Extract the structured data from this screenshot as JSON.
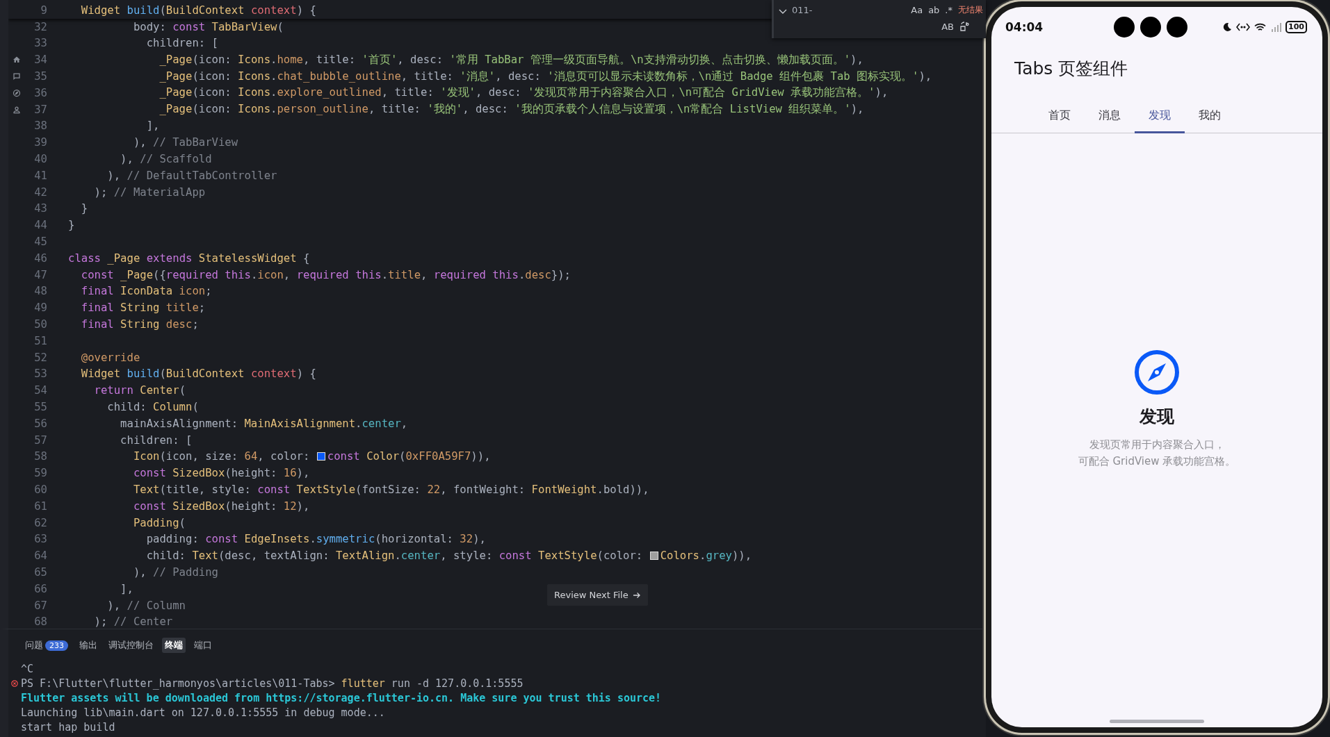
{
  "find_widget": {
    "value": "011-",
    "toggles": [
      "Aa",
      "ab",
      ".*"
    ],
    "result": "无结果",
    "replace_toggle": "AB"
  },
  "editor": {
    "sticky_line": {
      "num": "9",
      "tokens": [
        {
          "kind": "type",
          "text": "  Widget "
        },
        {
          "kind": "func",
          "text": "build"
        },
        {
          "kind": "plain",
          "text": "("
        },
        {
          "kind": "type",
          "text": "BuildContext "
        },
        {
          "kind": "var",
          "text": "context"
        },
        {
          "kind": "plain",
          "text": ") {"
        }
      ]
    },
    "lines": [
      {
        "num": "32",
        "tokens": [
          {
            "kind": "plain",
            "text": "          body: "
          },
          {
            "kind": "keyword",
            "text": "const "
          },
          {
            "kind": "type",
            "text": "TabBarView"
          },
          {
            "kind": "plain",
            "text": "("
          }
        ]
      },
      {
        "num": "33",
        "tokens": [
          {
            "kind": "plain",
            "text": "            children: ["
          }
        ]
      },
      {
        "num": "34",
        "kind": "home",
        "tokens": [
          {
            "kind": "type",
            "text": "              _Page"
          },
          {
            "kind": "plain",
            "text": "(icon: "
          },
          {
            "kind": "type",
            "text": "Icons"
          },
          {
            "kind": "plain",
            "text": "."
          },
          {
            "kind": "prop",
            "text": "home"
          },
          {
            "kind": "plain",
            "text": ", title: "
          },
          {
            "kind": "string",
            "text": "'首页'"
          },
          {
            "kind": "plain",
            "text": ", desc: "
          },
          {
            "kind": "string",
            "text": "'常用 TabBar 管理一级页面导航。\\n支持滑动切换、点击切换、懒加载页面。'"
          },
          {
            "kind": "plain",
            "text": "),"
          }
        ]
      },
      {
        "num": "35",
        "kind": "chat",
        "tokens": [
          {
            "kind": "type",
            "text": "              _Page"
          },
          {
            "kind": "plain",
            "text": "(icon: "
          },
          {
            "kind": "type",
            "text": "Icons"
          },
          {
            "kind": "plain",
            "text": "."
          },
          {
            "kind": "prop",
            "text": "chat_bubble_outline"
          },
          {
            "kind": "plain",
            "text": ", title: "
          },
          {
            "kind": "string",
            "text": "'消息'"
          },
          {
            "kind": "plain",
            "text": ", desc: "
          },
          {
            "kind": "string",
            "text": "'消息页可以显示未读数角标，\\n通过 Badge 组件包裹 Tab 图标实现。'"
          },
          {
            "kind": "plain",
            "text": "),"
          }
        ]
      },
      {
        "num": "36",
        "kind": "compass",
        "tokens": [
          {
            "kind": "type",
            "text": "              _Page"
          },
          {
            "kind": "plain",
            "text": "(icon: "
          },
          {
            "kind": "type",
            "text": "Icons"
          },
          {
            "kind": "plain",
            "text": "."
          },
          {
            "kind": "prop",
            "text": "explore_outlined"
          },
          {
            "kind": "plain",
            "text": ", title: "
          },
          {
            "kind": "string",
            "text": "'发现'"
          },
          {
            "kind": "plain",
            "text": ", desc: "
          },
          {
            "kind": "string",
            "text": "'发现页常用于内容聚合入口，\\n可配合 GridView 承载功能宫格。'"
          },
          {
            "kind": "plain",
            "text": "),"
          }
        ]
      },
      {
        "num": "37",
        "kind": "person",
        "tokens": [
          {
            "kind": "type",
            "text": "              _Page"
          },
          {
            "kind": "plain",
            "text": "(icon: "
          },
          {
            "kind": "type",
            "text": "Icons"
          },
          {
            "kind": "plain",
            "text": "."
          },
          {
            "kind": "prop",
            "text": "person_outline"
          },
          {
            "kind": "plain",
            "text": ", title: "
          },
          {
            "kind": "string",
            "text": "'我的'"
          },
          {
            "kind": "plain",
            "text": ", desc: "
          },
          {
            "kind": "string",
            "text": "'我的页承载个人信息与设置项，\\n常配合 ListView 组织菜单。'"
          },
          {
            "kind": "plain",
            "text": "),"
          }
        ]
      },
      {
        "num": "38",
        "tokens": [
          {
            "kind": "plain",
            "text": "            ],"
          }
        ]
      },
      {
        "num": "39",
        "tokens": [
          {
            "kind": "plain",
            "text": "          ), "
          },
          {
            "kind": "comment",
            "text": "// TabBarView"
          }
        ]
      },
      {
        "num": "40",
        "tokens": [
          {
            "kind": "plain",
            "text": "        ), "
          },
          {
            "kind": "comment",
            "text": "// Scaffold"
          }
        ]
      },
      {
        "num": "41",
        "tokens": [
          {
            "kind": "plain",
            "text": "      ), "
          },
          {
            "kind": "comment",
            "text": "// DefaultTabController"
          }
        ]
      },
      {
        "num": "42",
        "tokens": [
          {
            "kind": "plain",
            "text": "    ); "
          },
          {
            "kind": "comment",
            "text": "// MaterialApp"
          }
        ]
      },
      {
        "num": "43",
        "tokens": [
          {
            "kind": "plain",
            "text": "  }"
          }
        ]
      },
      {
        "num": "44",
        "tokens": [
          {
            "kind": "plain",
            "text": "}"
          }
        ]
      },
      {
        "num": "45"
      },
      {
        "num": "46",
        "tokens": [
          {
            "kind": "keyword",
            "text": "class "
          },
          {
            "kind": "type",
            "text": "_Page "
          },
          {
            "kind": "keyword",
            "text": "extends "
          },
          {
            "kind": "type",
            "text": "StatelessWidget"
          },
          {
            "kind": "plain",
            "text": " {"
          }
        ]
      },
      {
        "num": "47",
        "tokens": [
          {
            "kind": "keyword",
            "text": "  const "
          },
          {
            "kind": "type",
            "text": "_Page"
          },
          {
            "kind": "plain",
            "text": "({"
          },
          {
            "kind": "keyword",
            "text": "required this"
          },
          {
            "kind": "plain",
            "text": "."
          },
          {
            "kind": "prop",
            "text": "icon"
          },
          {
            "kind": "plain",
            "text": ", "
          },
          {
            "kind": "keyword",
            "text": "required this"
          },
          {
            "kind": "plain",
            "text": "."
          },
          {
            "kind": "prop",
            "text": "title"
          },
          {
            "kind": "plain",
            "text": ", "
          },
          {
            "kind": "keyword",
            "text": "required this"
          },
          {
            "kind": "plain",
            "text": "."
          },
          {
            "kind": "prop",
            "text": "desc"
          },
          {
            "kind": "plain",
            "text": "});"
          }
        ]
      },
      {
        "num": "48",
        "tokens": [
          {
            "kind": "keyword",
            "text": "  final "
          },
          {
            "kind": "type",
            "text": "IconData "
          },
          {
            "kind": "prop",
            "text": "icon"
          },
          {
            "kind": "plain",
            "text": ";"
          }
        ]
      },
      {
        "num": "49",
        "tokens": [
          {
            "kind": "keyword",
            "text": "  final "
          },
          {
            "kind": "type",
            "text": "String "
          },
          {
            "kind": "prop",
            "text": "title"
          },
          {
            "kind": "plain",
            "text": ";"
          }
        ]
      },
      {
        "num": "50",
        "tokens": [
          {
            "kind": "keyword",
            "text": "  final "
          },
          {
            "kind": "type",
            "text": "String "
          },
          {
            "kind": "prop",
            "text": "desc"
          },
          {
            "kind": "plain",
            "text": ";"
          }
        ]
      },
      {
        "num": "51"
      },
      {
        "num": "52",
        "tokens": [
          {
            "kind": "prop",
            "text": "  @override"
          }
        ]
      },
      {
        "num": "53",
        "tokens": [
          {
            "kind": "type",
            "text": "  Widget "
          },
          {
            "kind": "func",
            "text": "build"
          },
          {
            "kind": "plain",
            "text": "("
          },
          {
            "kind": "type",
            "text": "BuildContext "
          },
          {
            "kind": "var",
            "text": "context"
          },
          {
            "kind": "plain",
            "text": ") {"
          }
        ]
      },
      {
        "num": "54",
        "tokens": [
          {
            "kind": "keyword",
            "text": "    return "
          },
          {
            "kind": "type",
            "text": "Center"
          },
          {
            "kind": "plain",
            "text": "("
          }
        ]
      },
      {
        "num": "55",
        "tokens": [
          {
            "kind": "plain",
            "text": "      child: "
          },
          {
            "kind": "type",
            "text": "Column"
          },
          {
            "kind": "plain",
            "text": "("
          }
        ]
      },
      {
        "num": "56",
        "tokens": [
          {
            "kind": "plain",
            "text": "        mainAxisAlignment: "
          },
          {
            "kind": "type",
            "text": "MainAxisAlignment"
          },
          {
            "kind": "plain",
            "text": "."
          },
          {
            "kind": "enum",
            "text": "center"
          },
          {
            "kind": "plain",
            "text": ","
          }
        ]
      },
      {
        "num": "57",
        "tokens": [
          {
            "kind": "plain",
            "text": "        children: ["
          }
        ]
      },
      {
        "num": "58",
        "tokens": [
          {
            "kind": "type",
            "text": "          Icon"
          },
          {
            "kind": "plain",
            "text": "(icon, size: "
          },
          {
            "kind": "number",
            "text": "64"
          },
          {
            "kind": "plain",
            "text": ", color: "
          },
          {
            "kind": "swatch",
            "color": "#0a59f7"
          },
          {
            "kind": "keyword",
            "text": "const "
          },
          {
            "kind": "type",
            "text": "Color"
          },
          {
            "kind": "plain",
            "text": "("
          },
          {
            "kind": "number",
            "text": "0xFF0A59F7"
          },
          {
            "kind": "plain",
            "text": ")),"
          }
        ]
      },
      {
        "num": "59",
        "tokens": [
          {
            "kind": "keyword",
            "text": "          const "
          },
          {
            "kind": "type",
            "text": "SizedBox"
          },
          {
            "kind": "plain",
            "text": "(height: "
          },
          {
            "kind": "number",
            "text": "16"
          },
          {
            "kind": "plain",
            "text": "),"
          }
        ]
      },
      {
        "num": "60",
        "tokens": [
          {
            "kind": "type",
            "text": "          Text"
          },
          {
            "kind": "plain",
            "text": "(title, style: "
          },
          {
            "kind": "keyword",
            "text": "const "
          },
          {
            "kind": "type",
            "text": "TextStyle"
          },
          {
            "kind": "plain",
            "text": "(fontSize: "
          },
          {
            "kind": "number",
            "text": "22"
          },
          {
            "kind": "plain",
            "text": ", fontWeight: "
          },
          {
            "kind": "type",
            "text": "FontWeight"
          },
          {
            "kind": "plain",
            "text": ".bold)),"
          }
        ]
      },
      {
        "num": "61",
        "tokens": [
          {
            "kind": "keyword",
            "text": "          const "
          },
          {
            "kind": "type",
            "text": "SizedBox"
          },
          {
            "kind": "plain",
            "text": "(height: "
          },
          {
            "kind": "number",
            "text": "12"
          },
          {
            "kind": "plain",
            "text": "),"
          }
        ]
      },
      {
        "num": "62",
        "tokens": [
          {
            "kind": "type",
            "text": "          Padding"
          },
          {
            "kind": "plain",
            "text": "("
          }
        ]
      },
      {
        "num": "63",
        "tokens": [
          {
            "kind": "plain",
            "text": "            padding: "
          },
          {
            "kind": "keyword",
            "text": "const "
          },
          {
            "kind": "type",
            "text": "EdgeInsets"
          },
          {
            "kind": "plain",
            "text": "."
          },
          {
            "kind": "func",
            "text": "symmetric"
          },
          {
            "kind": "plain",
            "text": "(horizontal: "
          },
          {
            "kind": "number",
            "text": "32"
          },
          {
            "kind": "plain",
            "text": "),"
          }
        ]
      },
      {
        "num": "64",
        "tokens": [
          {
            "kind": "plain",
            "text": "            child: "
          },
          {
            "kind": "type",
            "text": "Text"
          },
          {
            "kind": "plain",
            "text": "(desc, textAlign: "
          },
          {
            "kind": "type",
            "text": "TextAlign"
          },
          {
            "kind": "plain",
            "text": "."
          },
          {
            "kind": "enum",
            "text": "center"
          },
          {
            "kind": "plain",
            "text": ", style: "
          },
          {
            "kind": "keyword",
            "text": "const "
          },
          {
            "kind": "type",
            "text": "TextStyle"
          },
          {
            "kind": "plain",
            "text": "(color: "
          },
          {
            "kind": "swatch",
            "color": "#9e9e9e"
          },
          {
            "kind": "type",
            "text": "Colors"
          },
          {
            "kind": "plain",
            "text": "."
          },
          {
            "kind": "enum",
            "text": "grey"
          },
          {
            "kind": "plain",
            "text": ")),"
          }
        ]
      },
      {
        "num": "65",
        "tokens": [
          {
            "kind": "plain",
            "text": "          ), "
          },
          {
            "kind": "comment",
            "text": "// Padding"
          }
        ]
      },
      {
        "num": "66",
        "tokens": [
          {
            "kind": "plain",
            "text": "        ],"
          }
        ]
      },
      {
        "num": "67",
        "tokens": [
          {
            "kind": "plain",
            "text": "      ), "
          },
          {
            "kind": "comment",
            "text": "// Column"
          }
        ]
      },
      {
        "num": "68",
        "tokens": [
          {
            "kind": "plain",
            "text": "    ); "
          },
          {
            "kind": "comment",
            "text": "// Center"
          }
        ]
      }
    ],
    "review_button": "Review Next File"
  },
  "panel": {
    "tabs": [
      {
        "label": "问题",
        "badge": "233",
        "selected": false
      },
      {
        "label": "输出",
        "selected": false
      },
      {
        "label": "调试控制台",
        "selected": false
      },
      {
        "label": "终端",
        "selected": true
      },
      {
        "label": "端口",
        "selected": false
      }
    ],
    "terminal": [
      {
        "error": false,
        "tokens": [
          {
            "kind": "plain",
            "text": "^C"
          }
        ]
      },
      {
        "error": true,
        "tokens": [
          {
            "kind": "plain",
            "text": "PS F:\\Flutter\\flutter_harmonyos\\articles\\011-Tabs> "
          },
          {
            "kind": "command",
            "text": "flutter"
          },
          {
            "kind": "plain",
            "text": " run -d 127.0.0.1:5555"
          }
        ]
      },
      {
        "error": false,
        "tokens": [
          {
            "kind": "highlight",
            "text": "Flutter assets will be downloaded from https://storage.flutter-io.cn. Make sure you trust this source!"
          }
        ]
      },
      {
        "error": false,
        "tokens": [
          {
            "kind": "plain",
            "text": "Launching lib\\main.dart on 127.0.0.1:5555 in debug mode..."
          }
        ]
      },
      {
        "error": false,
        "tokens": [
          {
            "kind": "plain",
            "text": "start hap build"
          }
        ]
      }
    ]
  },
  "phone": {
    "status": {
      "time": "04:04",
      "battery": "100"
    },
    "app_title": "Tabs 页签组件",
    "tabs": [
      {
        "label": "首页",
        "selected": false
      },
      {
        "label": "消息",
        "selected": false
      },
      {
        "label": "发现",
        "selected": true
      },
      {
        "label": "我的",
        "selected": false
      }
    ],
    "page": {
      "title": "发现",
      "desc": "发现页常用于内容聚合入口，可配合 GridView 承载功能宫格。"
    }
  }
}
